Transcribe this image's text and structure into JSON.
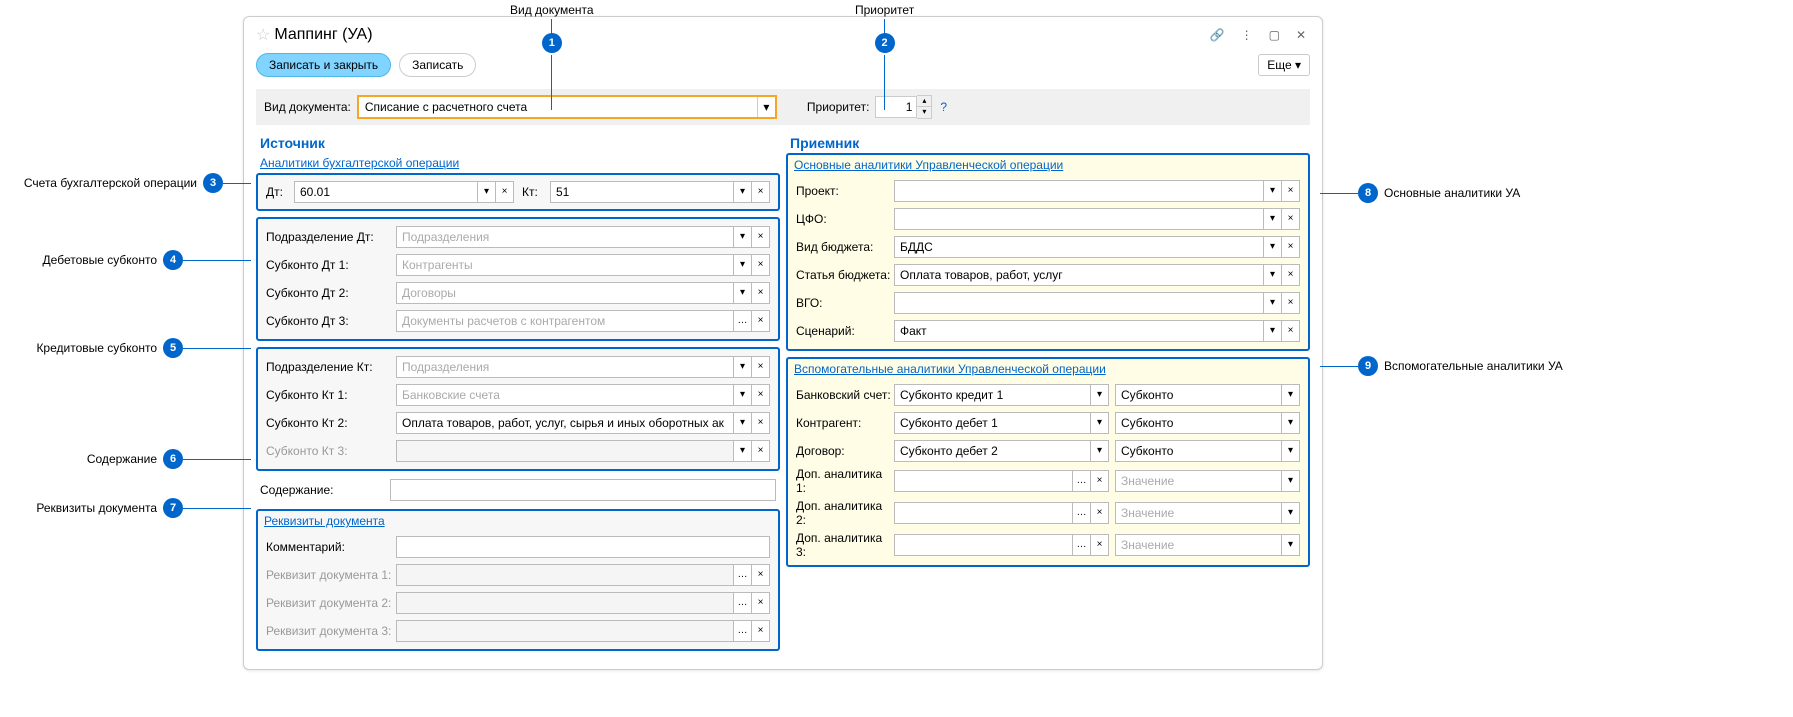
{
  "title": "Маппинг (УА)",
  "toolbar": {
    "save_close": "Записать и закрыть",
    "save": "Записать",
    "more": "Еще"
  },
  "header": {
    "doc_type_label": "Вид документа:",
    "doc_type_value": "Списание с расчетного счета",
    "priority_label": "Приоритет:",
    "priority_value": "1"
  },
  "source": {
    "title": "Источник",
    "analytics_header": "Аналитики бухгалтерской операции",
    "dt_label": "Дт:",
    "dt_value": "60.01",
    "kt_label": "Кт:",
    "kt_value": "51",
    "debit": {
      "div_label": "Подразделение Дт:",
      "div_ph": "Подразделения",
      "s1_label": "Субконто Дт 1:",
      "s1_ph": "Контрагенты",
      "s2_label": "Субконто Дт 2:",
      "s2_ph": "Договоры",
      "s3_label": "Субконто Дт 3:",
      "s3_ph": "Документы расчетов с контрагентом"
    },
    "credit": {
      "div_label": "Подразделение Кт:",
      "div_ph": "Подразделения",
      "s1_label": "Субконто Кт 1:",
      "s1_ph": "Банковские счета",
      "s2_label": "Субконто Кт 2:",
      "s2_value": "Оплата товаров, работ, услуг, сырья и иных оборотных ак",
      "s3_label": "Субконто Кт 3:"
    },
    "content_label": "Содержание:",
    "requisites": {
      "header": "Реквизиты документа",
      "comment_label": "Комментарий:",
      "r1_label": "Реквизит документа 1:",
      "r2_label": "Реквизит документа 2:",
      "r3_label": "Реквизит документа 3:"
    }
  },
  "target": {
    "title": "Приемник",
    "main_header": "Основные аналитики Управленческой операции",
    "project_label": "Проект:",
    "cfo_label": "ЦФО:",
    "budget_type_label": "Вид бюджета:",
    "budget_type_value": "БДДС",
    "budget_item_label": "Статья бюджета:",
    "budget_item_value": "Оплата товаров, работ, услуг",
    "vgo_label": "ВГО:",
    "scenario_label": "Сценарий:",
    "scenario_value": "Факт",
    "aux_header": "Вспомогательные аналитики Управленческой операции",
    "bank_label": "Банковский счет:",
    "bank_value": "Субконто кредит 1",
    "contractor_label": "Контрагент:",
    "contractor_value": "Субконто дебет 1",
    "contract_label": "Договор:",
    "contract_value": "Субконто дебет 2",
    "subkonto_type": "Субконто",
    "value_ph": "Значение",
    "a1_label": "Доп. аналитика 1:",
    "a2_label": "Доп. аналитика 2:",
    "a3_label": "Доп. аналитика 3:"
  },
  "callouts": {
    "c1": "Вид документа",
    "c2": "Приоритет",
    "c3": "Счета бухгалтерской операции",
    "c4": "Дебетовые субконто",
    "c5": "Кредитовые субконто",
    "c6": "Содержание",
    "c7": "Реквизиты документа",
    "c8": "Основные аналитики УА",
    "c9": "Вспомогательные аналитики УА"
  }
}
